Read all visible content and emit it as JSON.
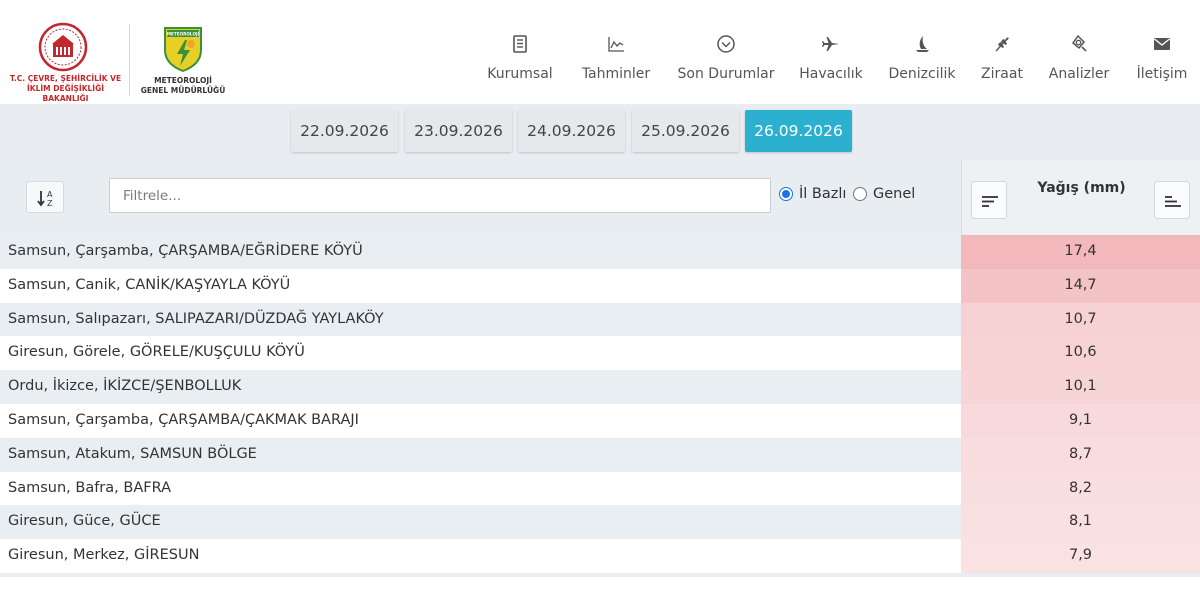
{
  "header": {
    "ministry_text_line1": "T.C. ÇEVRE, ŞEHİRCİLİK VE",
    "ministry_text_line2": "İKLİM DEĞİŞİKLİĞİ BAKANLIĞI",
    "mgm_logo_text": "METEOROLOJİ",
    "mgm_text_line1": "METEOROLOJİ",
    "mgm_text_line2": "GENEL MÜDÜRLÜĞÜ",
    "brand_red": "#c1272d",
    "nav": [
      {
        "label": "Kurumsal",
        "icon": "document-icon"
      },
      {
        "label": "Tahminler",
        "icon": "chart-icon"
      },
      {
        "label": "Son Durumlar",
        "icon": "chevron-circle-icon"
      },
      {
        "label": "Havacılık",
        "icon": "plane-icon"
      },
      {
        "label": "Denizcilik",
        "icon": "sail-icon"
      },
      {
        "label": "Ziraat",
        "icon": "wheat-icon"
      },
      {
        "label": "Analizler",
        "icon": "magnifier-icon"
      },
      {
        "label": "İletişim",
        "icon": "envelope-icon"
      }
    ]
  },
  "dates": {
    "items": [
      "22.09.2026",
      "23.09.2026",
      "24.09.2026",
      "25.09.2026",
      "26.09.2026"
    ],
    "active_index": 4,
    "active_color": "#2bb0cf"
  },
  "filters": {
    "search_placeholder": "Filtrele...",
    "search_value": "",
    "radio_il_bazli": "İl Bazlı",
    "radio_genel": "Genel",
    "selected": "İl Bazlı"
  },
  "table": {
    "value_header": "Yağış (mm)",
    "rows": [
      {
        "name": "Samsun, Çarşamba, ÇARŞAMBA/EĞRİDERE KÖYÜ",
        "value": "17,4",
        "color": "#f2b8bc"
      },
      {
        "name": "Samsun, Canik, CANİK/KAŞYAYLA KÖYÜ",
        "value": "14,7",
        "color": "#f3c3c6"
      },
      {
        "name": "Samsun, Salıpazarı, SALIPAZARI/DÜZDAĞ YAYLAKÖY",
        "value": "10,7",
        "color": "#f6d2d4"
      },
      {
        "name": "Giresun, Görele, GÖRELE/KUŞÇULU KÖYÜ",
        "value": "10,6",
        "color": "#f7d3d5"
      },
      {
        "name": "Ordu, İkizce, İKİZCE/ŞENBOLLUK",
        "value": "10,1",
        "color": "#f7d5d7"
      },
      {
        "name": "Samsun, Çarşamba, ÇARŞAMBA/ÇAKMAK BARAJI",
        "value": "9,1",
        "color": "#f8dadc"
      },
      {
        "name": "Samsun, Atakum, SAMSUN BÖLGE",
        "value": "8,7",
        "color": "#f9dcde"
      },
      {
        "name": "Samsun, Bafra, BAFRA",
        "value": "8,2",
        "color": "#f9dfe0"
      },
      {
        "name": "Giresun, Güce, GÜCE",
        "value": "8,1",
        "color": "#f9e0e1"
      },
      {
        "name": "Giresun, Merkez, GİRESUN",
        "value": "7,9",
        "color": "#fae2e3"
      }
    ]
  }
}
